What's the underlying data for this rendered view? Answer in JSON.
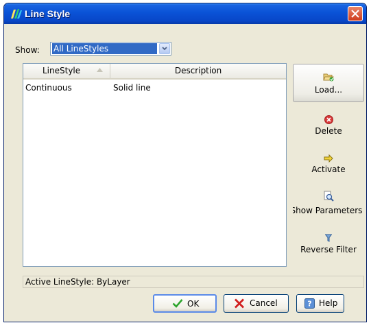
{
  "window": {
    "title": "Line Style",
    "app_icon": "line-style-app-icon",
    "close_icon": "close-icon"
  },
  "filter": {
    "label": "Show:",
    "selected": "All LineStyles"
  },
  "list": {
    "columns": [
      "LineStyle",
      "Description"
    ],
    "sort_icon": "sort-ascending-icon",
    "rows": [
      {
        "linestyle": "Continuous",
        "description": "Solid line"
      }
    ]
  },
  "side_buttons": {
    "load": {
      "label": "Load...",
      "icon": "folder-open-icon"
    },
    "delete": {
      "label": "Delete",
      "icon": "delete-icon"
    },
    "activate": {
      "label": "Activate",
      "icon": "arrow-right-icon"
    },
    "show_parameters": {
      "label": "Show Parameters",
      "icon": "magnifier-page-icon"
    },
    "reverse_filter": {
      "label": "Reverse Filter",
      "icon": "filter-icon"
    }
  },
  "status": {
    "text": "Active LineStyle: ByLayer"
  },
  "buttons": {
    "ok": {
      "label": "OK",
      "icon": "checkmark-icon"
    },
    "cancel": {
      "label": "Cancel",
      "icon": "cancel-x-icon"
    },
    "help": {
      "label": "Help",
      "icon": "help-icon"
    }
  },
  "colors": {
    "titlebar": "#0a52d6",
    "window_bg": "#ece9d8",
    "selection": "#316ac5"
  }
}
